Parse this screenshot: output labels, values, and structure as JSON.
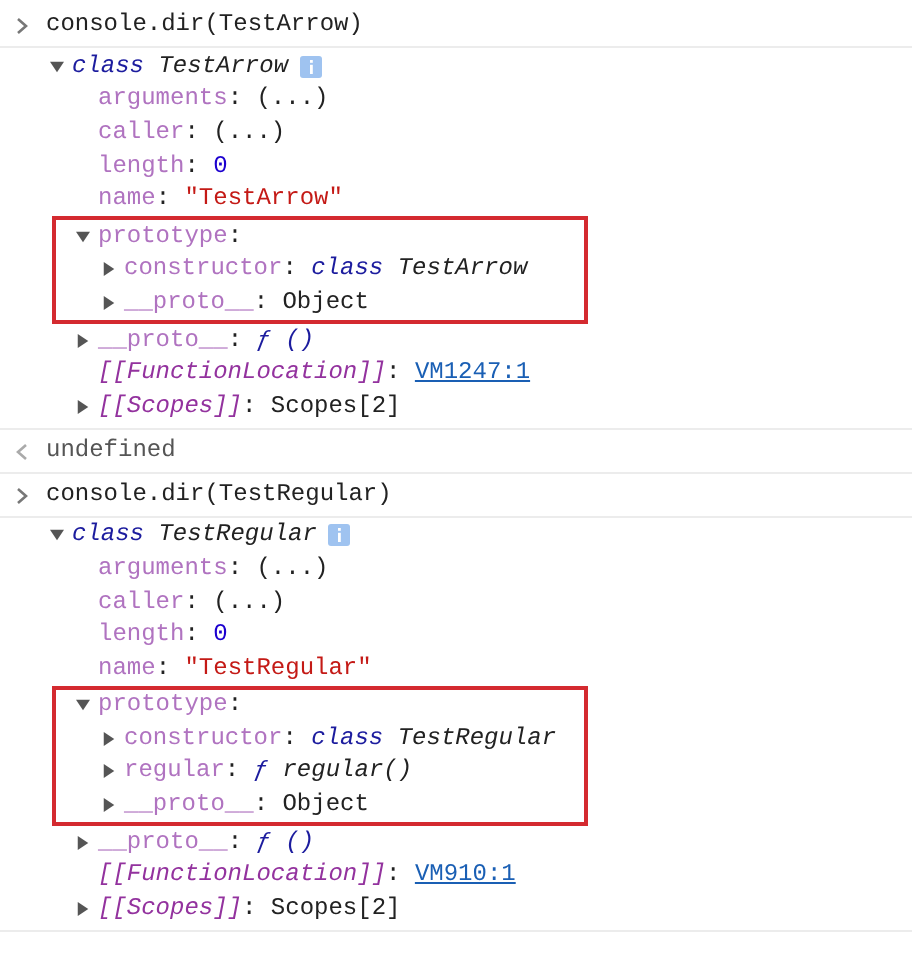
{
  "entries": [
    {
      "kind": "input",
      "text": "console.dir(TestArrow)"
    },
    {
      "kind": "tree",
      "tree": {
        "expanded": true,
        "tokens": [
          {
            "kind": "keyword",
            "text": "class"
          },
          {
            "kind": "name",
            "text": " TestArrow"
          }
        ],
        "children": [
          {
            "outlined": false,
            "tokens": [
              {
                "kind": "key",
                "text": "arguments"
              },
              {
                "kind": "plain",
                "text": ": (...)"
              }
            ]
          },
          {
            "outlined": false,
            "tokens": [
              {
                "kind": "key",
                "text": "caller"
              },
              {
                "kind": "plain",
                "text": ": (...)"
              }
            ]
          },
          {
            "outlined": false,
            "tokens": [
              {
                "kind": "key",
                "text": "length"
              },
              {
                "kind": "plain",
                "text": ": "
              },
              {
                "kind": "number",
                "text": "0"
              }
            ]
          },
          {
            "outlined": false,
            "tokens": [
              {
                "kind": "key",
                "text": "name"
              },
              {
                "kind": "plain",
                "text": ": "
              },
              {
                "kind": "string",
                "text": "\"TestArrow\""
              }
            ]
          },
          {
            "outlined": true,
            "expanded": true,
            "tokens": [
              {
                "kind": "key",
                "text": "prototype"
              },
              {
                "kind": "plain",
                "text": ":"
              }
            ],
            "children": [
              {
                "expanded": false,
                "tokens": [
                  {
                    "kind": "key",
                    "text": "constructor"
                  },
                  {
                    "kind": "plain",
                    "text": ": "
                  },
                  {
                    "kind": "keyword",
                    "text": "class"
                  },
                  {
                    "kind": "name",
                    "text": " TestArrow"
                  }
                ]
              },
              {
                "expanded": false,
                "tokens": [
                  {
                    "kind": "key",
                    "text": "__proto__"
                  },
                  {
                    "kind": "plain",
                    "text": ": Object"
                  }
                ]
              }
            ]
          },
          {
            "outlined": false,
            "expanded": false,
            "tokens": [
              {
                "kind": "key",
                "text": "__proto__"
              },
              {
                "kind": "plain",
                "text": ": "
              },
              {
                "kind": "func",
                "text": "ƒ ()"
              }
            ]
          },
          {
            "outlined": false,
            "tokens": [
              {
                "kind": "internal",
                "text": "[[FunctionLocation]]"
              },
              {
                "kind": "plain",
                "text": ": "
              },
              {
                "kind": "link",
                "text": "VM1247:1"
              }
            ]
          },
          {
            "outlined": false,
            "expanded": false,
            "tokens": [
              {
                "kind": "internal",
                "text": "[[Scopes]]"
              },
              {
                "kind": "plain",
                "text": ": Scopes[2]"
              }
            ]
          }
        ]
      }
    },
    {
      "kind": "result",
      "text": "undefined"
    },
    {
      "kind": "input",
      "text": "console.dir(TestRegular)"
    },
    {
      "kind": "tree",
      "tree": {
        "expanded": true,
        "tokens": [
          {
            "kind": "keyword",
            "text": "class"
          },
          {
            "kind": "name",
            "text": " TestRegular"
          }
        ],
        "children": [
          {
            "outlined": false,
            "tokens": [
              {
                "kind": "key",
                "text": "arguments"
              },
              {
                "kind": "plain",
                "text": ": (...)"
              }
            ]
          },
          {
            "outlined": false,
            "tokens": [
              {
                "kind": "key",
                "text": "caller"
              },
              {
                "kind": "plain",
                "text": ": (...)"
              }
            ]
          },
          {
            "outlined": false,
            "tokens": [
              {
                "kind": "key",
                "text": "length"
              },
              {
                "kind": "plain",
                "text": ": "
              },
              {
                "kind": "number",
                "text": "0"
              }
            ]
          },
          {
            "outlined": false,
            "tokens": [
              {
                "kind": "key",
                "text": "name"
              },
              {
                "kind": "plain",
                "text": ": "
              },
              {
                "kind": "string",
                "text": "\"TestRegular\""
              }
            ]
          },
          {
            "outlined": true,
            "expanded": true,
            "tokens": [
              {
                "kind": "key",
                "text": "prototype"
              },
              {
                "kind": "plain",
                "text": ":"
              }
            ],
            "children": [
              {
                "expanded": false,
                "tokens": [
                  {
                    "kind": "key",
                    "text": "constructor"
                  },
                  {
                    "kind": "plain",
                    "text": ": "
                  },
                  {
                    "kind": "keyword",
                    "text": "class"
                  },
                  {
                    "kind": "name",
                    "text": " TestRegular"
                  }
                ]
              },
              {
                "expanded": false,
                "tokens": [
                  {
                    "kind": "key",
                    "text": "regular"
                  },
                  {
                    "kind": "plain",
                    "text": ": "
                  },
                  {
                    "kind": "func",
                    "text": "ƒ"
                  },
                  {
                    "kind": "name",
                    "text": " regular()"
                  }
                ]
              },
              {
                "expanded": false,
                "tokens": [
                  {
                    "kind": "key",
                    "text": "__proto__"
                  },
                  {
                    "kind": "plain",
                    "text": ": Object"
                  }
                ]
              }
            ]
          },
          {
            "outlined": false,
            "expanded": false,
            "tokens": [
              {
                "kind": "key",
                "text": "__proto__"
              },
              {
                "kind": "plain",
                "text": ": "
              },
              {
                "kind": "func",
                "text": "ƒ ()"
              }
            ]
          },
          {
            "outlined": false,
            "tokens": [
              {
                "kind": "internal",
                "text": "[[FunctionLocation]]"
              },
              {
                "kind": "plain",
                "text": ": "
              },
              {
                "kind": "link",
                "text": "VM910:1"
              }
            ]
          },
          {
            "outlined": false,
            "expanded": false,
            "tokens": [
              {
                "kind": "internal",
                "text": "[[Scopes]]"
              },
              {
                "kind": "plain",
                "text": ": Scopes[2]"
              }
            ]
          }
        ]
      }
    }
  ]
}
